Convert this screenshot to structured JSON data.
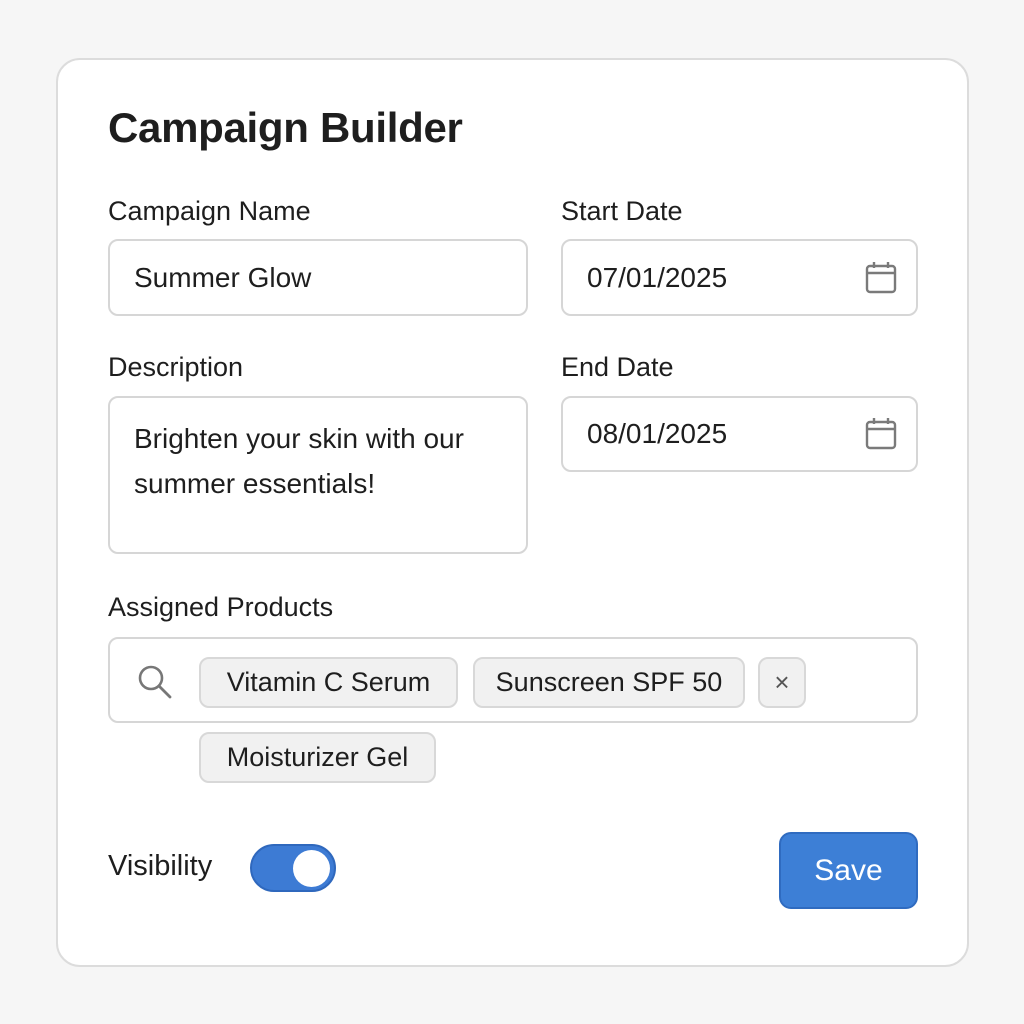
{
  "form": {
    "title": "Campaign Builder",
    "campaign_name": {
      "label": "Campaign Name",
      "value": "Summer Glow"
    },
    "start_date": {
      "label": "Start Date",
      "value": "07/01/2025",
      "icon": "calendar-icon"
    },
    "description": {
      "label": "Description",
      "value": "Brighten your skin with our summer essentials!"
    },
    "end_date": {
      "label": "End Date",
      "value": "08/01/2025",
      "icon": "calendar-icon"
    },
    "products": {
      "label": "Assigned Products",
      "search_icon": "search-icon",
      "chips": [
        "Vitamin C Serum",
        "Sunscreen SPF 50",
        "Moisturizer Gel"
      ],
      "remove_symbol": "×"
    },
    "visibility": {
      "label": "Visibility",
      "enabled": true
    },
    "save_label": "Save"
  },
  "colors": {
    "accent": "#3d7fd6",
    "border": "#d6d6d6",
    "chip_bg": "#f1f1f1",
    "card_bg": "#ffffff",
    "page_bg": "#f6f6f6"
  }
}
